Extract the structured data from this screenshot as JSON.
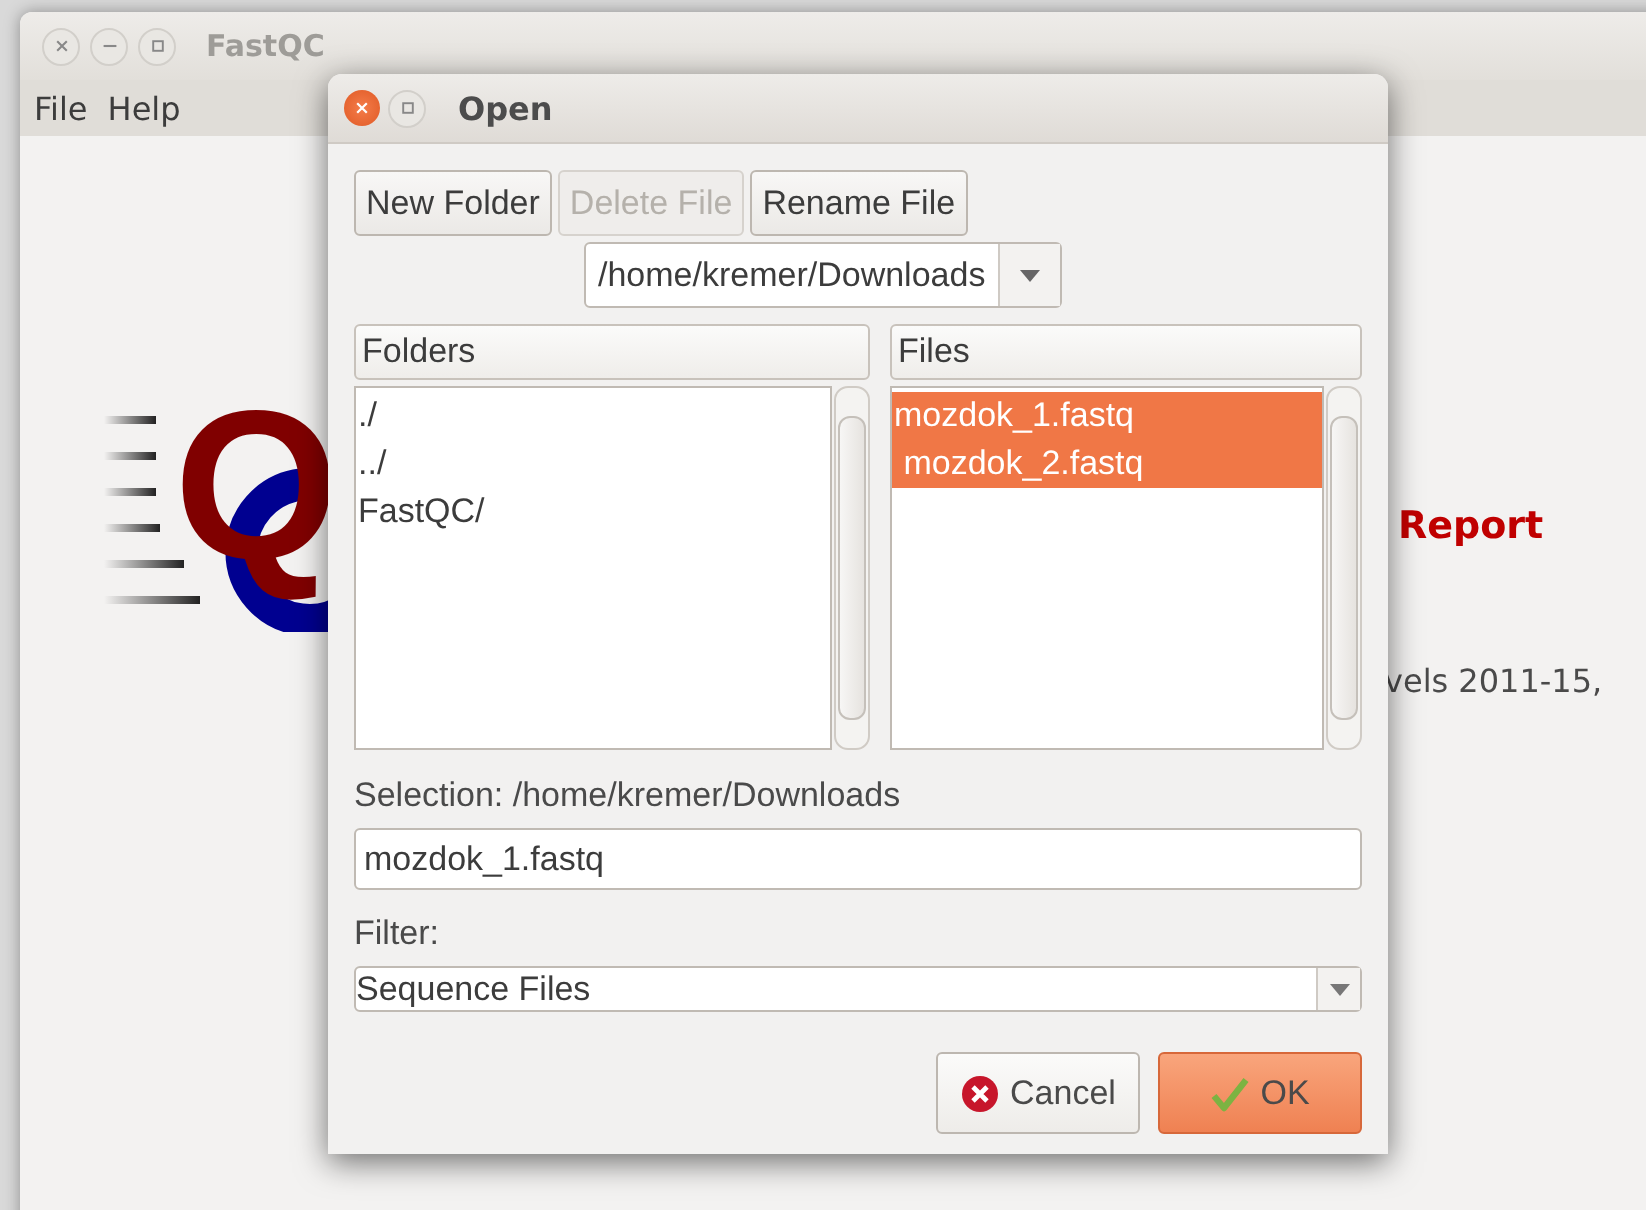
{
  "main_window": {
    "title": "FastQC",
    "menu": [
      "File",
      "Help"
    ],
    "logo_letter": "Q",
    "heading_fragment": "Report",
    "text_fragment": "vels 2011-15,"
  },
  "dialog": {
    "title": "Open",
    "toolbar": [
      {
        "label": "New Folder",
        "disabled": false
      },
      {
        "label": "Delete File",
        "disabled": true
      },
      {
        "label": "Rename File",
        "disabled": false
      }
    ],
    "path": "/home/kremer/Downloads",
    "folders": {
      "header": "Folders",
      "items": [
        {
          "label": "./",
          "selected": false
        },
        {
          "label": "../",
          "selected": false
        },
        {
          "label": "FastQC/",
          "selected": false
        }
      ]
    },
    "files": {
      "header": "Files",
      "items": [
        {
          "label": "mozdok_1.fastq",
          "selected": true
        },
        {
          "label": " mozdok_2.fastq",
          "selected": true
        }
      ]
    },
    "selection_label": "Selection: /home/kremer/Downloads",
    "selection_value": "mozdok_1.fastq",
    "filter_label": "Filter:",
    "filter_value": "Sequence Files",
    "buttons": [
      {
        "label": "Cancel",
        "kind": "cancel"
      },
      {
        "label": "OK",
        "kind": "ok"
      }
    ]
  }
}
